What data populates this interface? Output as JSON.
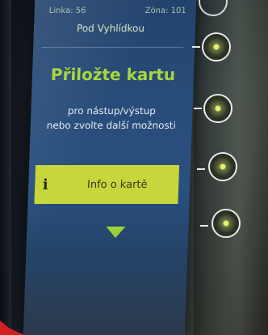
{
  "kiosk": {
    "header_left": "Linka: 56",
    "header_right": "Zóna: 101",
    "stop_name": "Pod Vyhlídkou",
    "prompt_title": "Přiložte kartu",
    "prompt_line1": "pro nástup/výstup",
    "prompt_line2": "nebo zvolte další možnosti",
    "info_icon": "i",
    "info_button_label": "Info o kartě",
    "scroll_icon": "triangle-down-icon"
  },
  "side_buttons": [
    {
      "name": "side-button-1"
    },
    {
      "name": "side-button-2"
    },
    {
      "name": "side-button-3"
    },
    {
      "name": "side-button-4"
    },
    {
      "name": "side-button-5"
    }
  ],
  "colors": {
    "screen_blue": "#284c79",
    "accent_green": "#a8d640",
    "info_bar": "#c7d63a",
    "arrow_green": "#9bd23a"
  }
}
